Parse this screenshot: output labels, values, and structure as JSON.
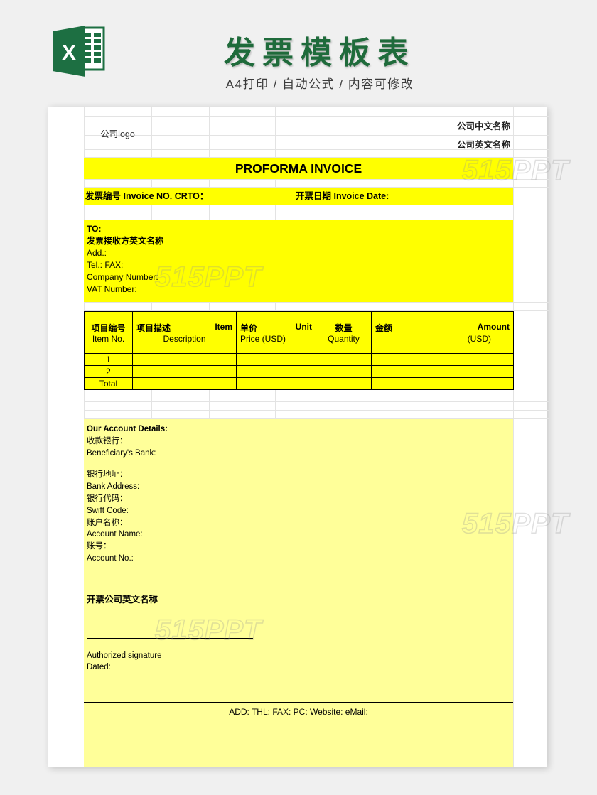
{
  "promo": {
    "logo_icon": "excel-file-icon",
    "title": "发票模板表",
    "subtitle": "A4打印 / 自动公式 / 内容可修改",
    "brand_color": "#1f6b3b"
  },
  "colors": {
    "bright_yellow": "#FFFF00",
    "light_yellow": "#FFFF99",
    "page_bg": "#F0F0F0",
    "excel_green": "#1D6F42"
  },
  "watermark": {
    "text": "515PPT",
    "occurrences": 4
  },
  "document": {
    "company": {
      "logo_placeholder": "公司logo",
      "name_cn": "公司中文名称",
      "name_en": "公司英文名称"
    },
    "doc_title": "PROFORMA    INVOICE",
    "invoice_meta": {
      "number_label": "发票编号 Invoice NO. CRTO：",
      "date_label": "开票日期 Invoice Date:"
    },
    "bill_to": {
      "heading": "TO:",
      "recipient": "发票接收方英文名称",
      "address": "Add.:",
      "tel_fax": "Tel.:        FAX:",
      "company_number": "Company  Number:",
      "vat_number": "VAT Number:"
    },
    "items_table": {
      "columns": [
        {
          "cn": "项目编号",
          "en": "Item No.",
          "sub": ""
        },
        {
          "cn": "项目描述",
          "en": "Item",
          "sub": "Description"
        },
        {
          "cn": "单价",
          "en": "Unit",
          "sub": "Price      (USD)"
        },
        {
          "cn": "数量",
          "en": "",
          "sub": "Quantity"
        },
        {
          "cn": "金额",
          "en": "Amount",
          "sub": "(USD)"
        }
      ],
      "rows": [
        {
          "no": "1",
          "description": "",
          "unit_price": "",
          "quantity": "",
          "amount": ""
        },
        {
          "no": "2",
          "description": "",
          "unit_price": "",
          "quantity": "",
          "amount": ""
        },
        {
          "no": "Total",
          "description": "",
          "unit_price": "",
          "quantity": "",
          "amount": ""
        }
      ]
    },
    "account_details": {
      "heading": "Our Account Details:",
      "bank_cn": "收款银行：",
      "bank_en": "Beneficiary's Bank:",
      "bank_address_cn": "银行地址：",
      "bank_address_en": "Bank Address:",
      "swift_cn": "银行代码：",
      "swift_en": "Swift Code:",
      "account_name_cn": "账户名称：",
      "account_name_en": "Account Name:",
      "account_no_cn": "账号：",
      "account_no_en": "Account No.:"
    },
    "signature": {
      "issuer_company": "开票公司英文名称",
      "authorized_signature": "Authorized signature",
      "dated": "Dated:"
    },
    "footer": {
      "contact_line": "ADD:   THL:  FAX:   PC:   Website:  eMail:"
    }
  }
}
